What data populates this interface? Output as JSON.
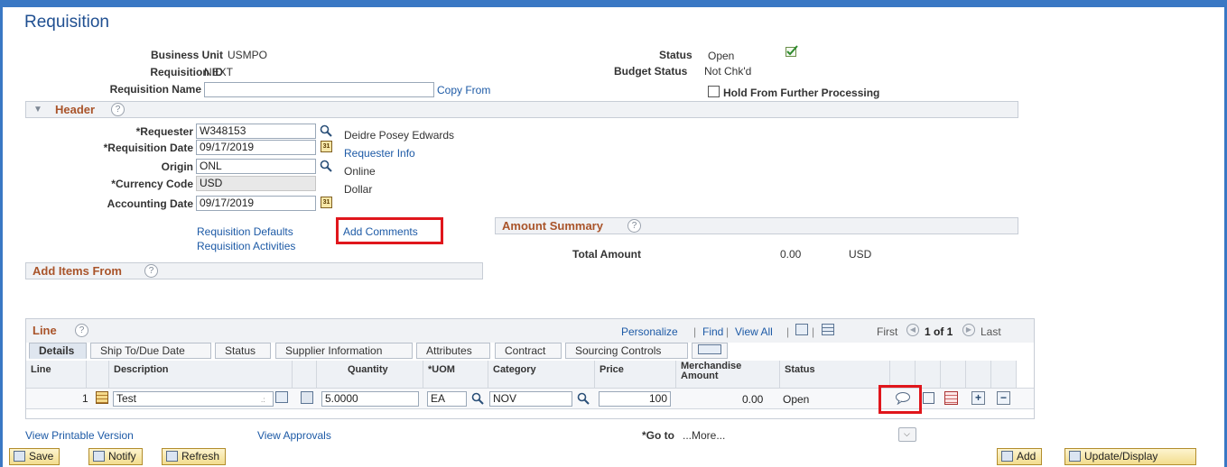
{
  "page": {
    "title": "Requisition"
  },
  "summary": {
    "business_unit_label": "Business Unit",
    "business_unit_value": "USMPO",
    "requisition_id_label": "Requisition ID",
    "requisition_id_value": "NEXT",
    "requisition_name_label": "Requisition Name",
    "requisition_name_value": "",
    "copy_from": "Copy From",
    "status_label": "Status",
    "status_value": "Open",
    "budget_status_label": "Budget Status",
    "budget_status_value": "Not Chk'd",
    "hold_label": "Hold From Further Processing"
  },
  "header": {
    "title": "Header",
    "help": "?",
    "requester_label": "*Requester",
    "requester_value": "W348153",
    "requester_name": "Deidre Posey Edwards",
    "req_date_label": "*Requisition Date",
    "req_date_value": "09/17/2019",
    "requester_info": "Requester Info",
    "origin_label": "Origin",
    "origin_value": "ONL",
    "origin_desc": "Online",
    "currency_label": "*Currency Code",
    "currency_value": "USD",
    "currency_desc": "Dollar",
    "acct_date_label": "Accounting Date",
    "acct_date_value": "09/17/2019",
    "cal_glyph": "31",
    "req_defaults": "Requisition Defaults",
    "req_activities": "Requisition Activities",
    "add_comments": "Add Comments"
  },
  "amount_summary": {
    "title": "Amount Summary",
    "total_label": "Total Amount",
    "total_value": "0.00",
    "currency": "USD"
  },
  "add_items": {
    "title": "Add Items From"
  },
  "line_grid": {
    "title": "Line",
    "personalize": "Personalize",
    "find": "Find",
    "view_all": "View All",
    "sep": "|",
    "first": "First",
    "range": "1 of 1",
    "last": "Last",
    "tabs": [
      "Details",
      "Ship To/Due Date",
      "Status",
      "Supplier Information",
      "Attributes",
      "Contract",
      "Sourcing Controls"
    ],
    "columns": {
      "line": "Line",
      "description": "Description",
      "quantity": "Quantity",
      "uom": "*UOM",
      "category": "Category",
      "price": "Price",
      "merch_amount": "Merchandise Amount",
      "status": "Status"
    },
    "row": {
      "line": "1",
      "description": "Test",
      "quantity": "5.0000",
      "uom": "EA",
      "category": "NOV",
      "price": "100",
      "merch_amount": "0.00",
      "status": "Open"
    },
    "add_row": "+",
    "delete_row": "−"
  },
  "footer": {
    "view_printable": "View Printable Version",
    "view_approvals": "View Approvals",
    "goto_label": "*Go to",
    "goto_value": "...More...",
    "save": "Save",
    "notify": "Notify",
    "refresh": "Refresh",
    "add": "Add",
    "update_display": "Update/Display"
  },
  "colors": {
    "accent": "#3a78c4",
    "highlight": "#e0161c",
    "section_title": "#a9542a",
    "link": "#1d5aa6"
  }
}
